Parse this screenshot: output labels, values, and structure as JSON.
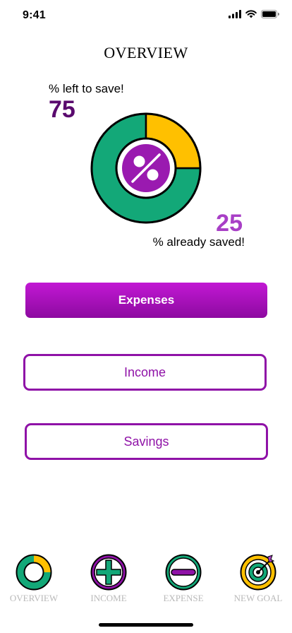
{
  "status": {
    "time": "9:41",
    "icons": [
      "signal-icon",
      "wifi-icon",
      "battery-icon"
    ]
  },
  "header": {
    "title": "OVERVIEW"
  },
  "summary": {
    "left_label": "% left to save!",
    "left_value": "75",
    "saved_value": "25",
    "saved_label": "% already saved!"
  },
  "chart_data": {
    "type": "pie",
    "categories": [
      "% left to save!",
      "% already saved!"
    ],
    "values": [
      75,
      25
    ],
    "colors": [
      "#13a878",
      "#ffc000"
    ],
    "center_icon": "percent-icon"
  },
  "buttons": {
    "expenses": "Expenses",
    "income": "Income",
    "savings": "Savings"
  },
  "tabbar": {
    "items": [
      {
        "label": "OVERVIEW",
        "icon": "donut-icon"
      },
      {
        "label": "INCOME",
        "icon": "plus-circle-icon"
      },
      {
        "label": "EXPENSE",
        "icon": "minus-circle-icon"
      },
      {
        "label": "NEW GOAL",
        "icon": "target-icon"
      }
    ]
  },
  "colors": {
    "accent": "#8f12a7",
    "dark_purple": "#5a0a6e",
    "light_purple": "#a83fc6",
    "green": "#13a878",
    "yellow": "#ffc000"
  }
}
